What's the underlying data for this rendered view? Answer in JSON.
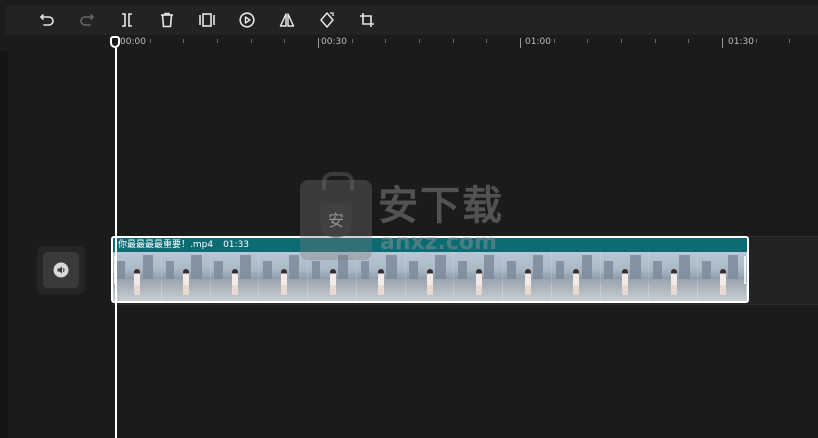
{
  "toolbar": {
    "buttons": [
      {
        "name": "undo",
        "icon": "undo-icon",
        "enabled": true
      },
      {
        "name": "redo",
        "icon": "redo-icon",
        "enabled": false
      },
      {
        "name": "split",
        "icon": "split-icon",
        "enabled": true
      },
      {
        "name": "delete",
        "icon": "trash-icon",
        "enabled": true
      },
      {
        "name": "freeze-frame",
        "icon": "freeze-frame-icon",
        "enabled": true
      },
      {
        "name": "reverse-play",
        "icon": "play-circle-icon",
        "enabled": true
      },
      {
        "name": "mirror",
        "icon": "mirror-icon",
        "enabled": true
      },
      {
        "name": "rotate",
        "icon": "rotate-icon",
        "enabled": true
      },
      {
        "name": "crop",
        "icon": "crop-icon",
        "enabled": true
      }
    ]
  },
  "ruler": {
    "labels": [
      "00:00",
      "00:30",
      "01:00",
      "01:30"
    ]
  },
  "clip": {
    "filename": "你最最最最重要！.mp4",
    "duration": "01:33"
  },
  "track": {
    "audio_icon": "volume-icon"
  },
  "watermark": {
    "text": "安下载",
    "url": "anxz.com"
  },
  "colors": {
    "background": "#1b1b1c",
    "toolbar": "#232325",
    "clip_header": "#0b6c74",
    "playhead": "#ffffff"
  }
}
